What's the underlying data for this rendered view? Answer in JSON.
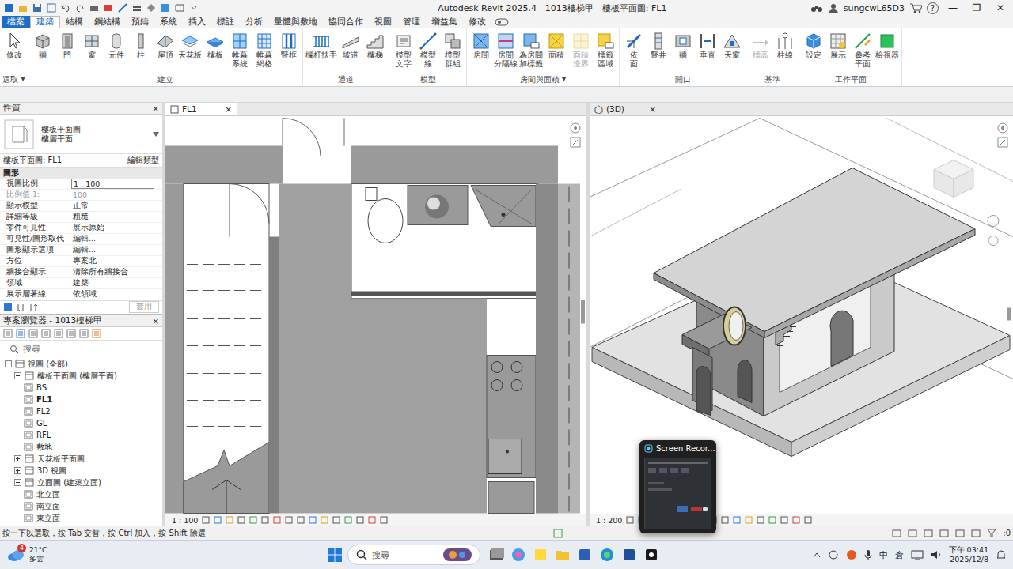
{
  "window": {
    "title": "Autodesk Revit 2025.4 - 1013樓梯甲 - 樓板平面圖: FL1",
    "user": "sungcwL65D3",
    "help": "?",
    "controls": [
      "—",
      "❐",
      "✕"
    ]
  },
  "ribbon": {
    "tabs": [
      {
        "label": "檔案",
        "selected": false,
        "kind": "file"
      },
      {
        "label": "建築",
        "selected": true,
        "kind": "tab"
      },
      {
        "label": "結構",
        "selected": false,
        "kind": "tab"
      },
      {
        "label": "鋼結構",
        "selected": false,
        "kind": "tab"
      },
      {
        "label": "預鑄",
        "selected": false,
        "kind": "tab"
      },
      {
        "label": "系統",
        "selected": false,
        "kind": "tab"
      },
      {
        "label": "插入",
        "selected": false,
        "kind": "tab"
      },
      {
        "label": "標註",
        "selected": false,
        "kind": "tab"
      },
      {
        "label": "分析",
        "selected": false,
        "kind": "tab"
      },
      {
        "label": "量體與敷地",
        "selected": false,
        "kind": "tab"
      },
      {
        "label": "協同合作",
        "selected": false,
        "kind": "tab"
      },
      {
        "label": "視圖",
        "selected": false,
        "kind": "tab"
      },
      {
        "label": "管理",
        "selected": false,
        "kind": "tab"
      },
      {
        "label": "增益集",
        "selected": false,
        "kind": "tab"
      },
      {
        "label": "修改",
        "selected": false,
        "kind": "tab"
      }
    ],
    "panels": [
      {
        "title": "選取",
        "arrow": "▾",
        "buttons": [
          {
            "label": [
              "修改"
            ],
            "disabled": false
          }
        ]
      },
      {
        "title": "建立",
        "buttons": [
          {
            "label": [
              "牆"
            ],
            "disabled": false
          },
          {
            "label": [
              "門"
            ],
            "disabled": false
          },
          {
            "label": [
              "窗"
            ],
            "disabled": false
          },
          {
            "label": [
              "元件"
            ],
            "disabled": false
          },
          {
            "label": [
              "柱"
            ],
            "disabled": false
          },
          {
            "label": [
              "屋頂"
            ],
            "disabled": false
          },
          {
            "label": [
              "天花板"
            ],
            "disabled": false
          },
          {
            "label": [
              "樓板"
            ],
            "disabled": false
          },
          {
            "label": [
              "帷幕",
              "系統"
            ],
            "disabled": false
          },
          {
            "label": [
              "帷幕",
              "網格"
            ],
            "disabled": false
          },
          {
            "label": [
              "豎框"
            ],
            "disabled": false
          }
        ]
      },
      {
        "title": "通道",
        "buttons": [
          {
            "label": [
              "欄杆扶手"
            ],
            "disabled": false
          },
          {
            "label": [
              "坡道"
            ],
            "disabled": false
          },
          {
            "label": [
              "樓梯"
            ],
            "disabled": false
          }
        ]
      },
      {
        "title": "模型",
        "buttons": [
          {
            "label": [
              "模型",
              "文字"
            ],
            "disabled": false
          },
          {
            "label": [
              "模型",
              "線"
            ],
            "disabled": false
          },
          {
            "label": [
              "模型",
              "群組"
            ],
            "disabled": false
          }
        ]
      },
      {
        "title": "房間與面積",
        "arrow": "▾",
        "buttons": [
          {
            "label": [
              "房間"
            ],
            "disabled": false
          },
          {
            "label": [
              "房間",
              "分隔線"
            ],
            "disabled": false
          },
          {
            "label": [
              "為房間",
              "加標籤"
            ],
            "disabled": false
          },
          {
            "label": [
              "面積"
            ],
            "disabled": false
          },
          {
            "label": [
              "面積",
              "邊界"
            ],
            "disabled": true
          },
          {
            "label": [
              "標籤",
              "區域"
            ],
            "disabled": false
          }
        ]
      },
      {
        "title": "開口",
        "buttons": [
          {
            "label": [
              "依",
              "面"
            ],
            "disabled": false
          },
          {
            "label": [
              "豎井"
            ],
            "disabled": false
          },
          {
            "label": [
              "牆"
            ],
            "disabled": false
          },
          {
            "label": [
              "垂直"
            ],
            "disabled": false
          },
          {
            "label": [
              "天窗"
            ],
            "disabled": false
          }
        ]
      },
      {
        "title": "基準",
        "buttons": [
          {
            "label": [
              "標高"
            ],
            "disabled": true
          },
          {
            "label": [
              "柱線"
            ],
            "disabled": false
          }
        ]
      },
      {
        "title": "工作平面",
        "buttons": [
          {
            "label": [
              "設定"
            ],
            "disabled": false
          },
          {
            "label": [
              "展示"
            ],
            "disabled": false
          },
          {
            "label": [
              "參考",
              "平面"
            ],
            "disabled": false
          },
          {
            "label": [
              "檢視器"
            ],
            "disabled": false
          }
        ]
      }
    ]
  },
  "properties": {
    "title": "性質",
    "close": "×",
    "type": [
      "樓板平面圖",
      "樓層平面"
    ],
    "instance": "樓板平面圖: FL1",
    "edit_type": "編輯類型",
    "section": "圖形",
    "rows": [
      {
        "label": "視圖比例",
        "value": "1 : 100",
        "kind": "input",
        "disabled": false
      },
      {
        "label": "比例值 1:",
        "value": "100",
        "kind": "text",
        "disabled": true
      },
      {
        "label": "顯示模型",
        "value": "正常",
        "kind": "text",
        "disabled": false
      },
      {
        "label": "詳細等級",
        "value": "粗糙",
        "kind": "text",
        "disabled": false
      },
      {
        "label": "零件可見性",
        "value": "展示原始",
        "kind": "text",
        "disabled": false
      },
      {
        "label": "可見性/圖形取代",
        "value": "編輯...",
        "kind": "button",
        "disabled": false
      },
      {
        "label": "圖形顯示選項",
        "value": "編輯...",
        "kind": "button",
        "disabled": false
      },
      {
        "label": "方位",
        "value": "專案北",
        "kind": "text",
        "disabled": false
      },
      {
        "label": "牆接合顯示",
        "value": "清除所有牆接合",
        "kind": "text",
        "disabled": false
      },
      {
        "label": "領域",
        "value": "建築",
        "kind": "text",
        "disabled": false
      },
      {
        "label": "展示層著線",
        "value": "依領域",
        "kind": "text",
        "disabled": false
      }
    ],
    "apply": {
      "label": "套用",
      "disabled": true
    }
  },
  "browser": {
    "title": "專案瀏覽器 - 1013樓梯甲",
    "close": "×",
    "search": {
      "placeholder": "搜尋"
    },
    "items": [
      {
        "label": "視圖 (全部)",
        "depth": 0,
        "kind": "folder",
        "expanded": true,
        "selected": false
      },
      {
        "label": "樓板平面圖 (樓層平面)",
        "depth": 1,
        "kind": "folder",
        "expanded": true,
        "selected": false
      },
      {
        "label": "BS",
        "depth": 2,
        "kind": "view",
        "expanded": false,
        "selected": false
      },
      {
        "label": "FL1",
        "depth": 2,
        "kind": "view",
        "expanded": false,
        "selected": true
      },
      {
        "label": "FL2",
        "depth": 2,
        "kind": "view",
        "expanded": false,
        "selected": false
      },
      {
        "label": "GL",
        "depth": 2,
        "kind": "view",
        "expanded": false,
        "selected": false
      },
      {
        "label": "RFL",
        "depth": 2,
        "kind": "view",
        "expanded": false,
        "selected": false
      },
      {
        "label": "敷地",
        "depth": 2,
        "kind": "view",
        "expanded": false,
        "selected": false
      },
      {
        "label": "天花板平面圖",
        "depth": 1,
        "kind": "folder",
        "expanded": false,
        "selected": false
      },
      {
        "label": "3D 視圖",
        "depth": 1,
        "kind": "folder",
        "expanded": false,
        "selected": false
      },
      {
        "label": "立面圖 (建築立面)",
        "depth": 1,
        "kind": "folder",
        "expanded": true,
        "selected": false
      },
      {
        "label": "北立面",
        "depth": 2,
        "kind": "view",
        "expanded": false,
        "selected": false
      },
      {
        "label": "南立面",
        "depth": 2,
        "kind": "view",
        "expanded": false,
        "selected": false
      },
      {
        "label": "東立面",
        "depth": 2,
        "kind": "view",
        "expanded": false,
        "selected": false
      }
    ]
  },
  "views": [
    {
      "tab": "FL1",
      "close": "×",
      "scale": "1 : 100",
      "selected": true,
      "kind": "plan"
    },
    {
      "tab": "(3D)",
      "close": "×",
      "scale": "1 : 200",
      "selected": false,
      "kind": "3d"
    }
  ],
  "status_bar": {
    "hint": "按一下以選取，按 Tab 交替，按 Ctrl 加入，按 Shift 除選",
    "count": ":0"
  },
  "taskbar": {
    "weather": {
      "badge": "4",
      "temp": "21°C",
      "desc": "多雲"
    },
    "search": {
      "placeholder": "搜尋"
    },
    "ime": [
      "中",
      "倉"
    ],
    "time": "下午 03:41",
    "date": "2025/12/8"
  },
  "recorder": {
    "title": "Screen Recor..."
  }
}
